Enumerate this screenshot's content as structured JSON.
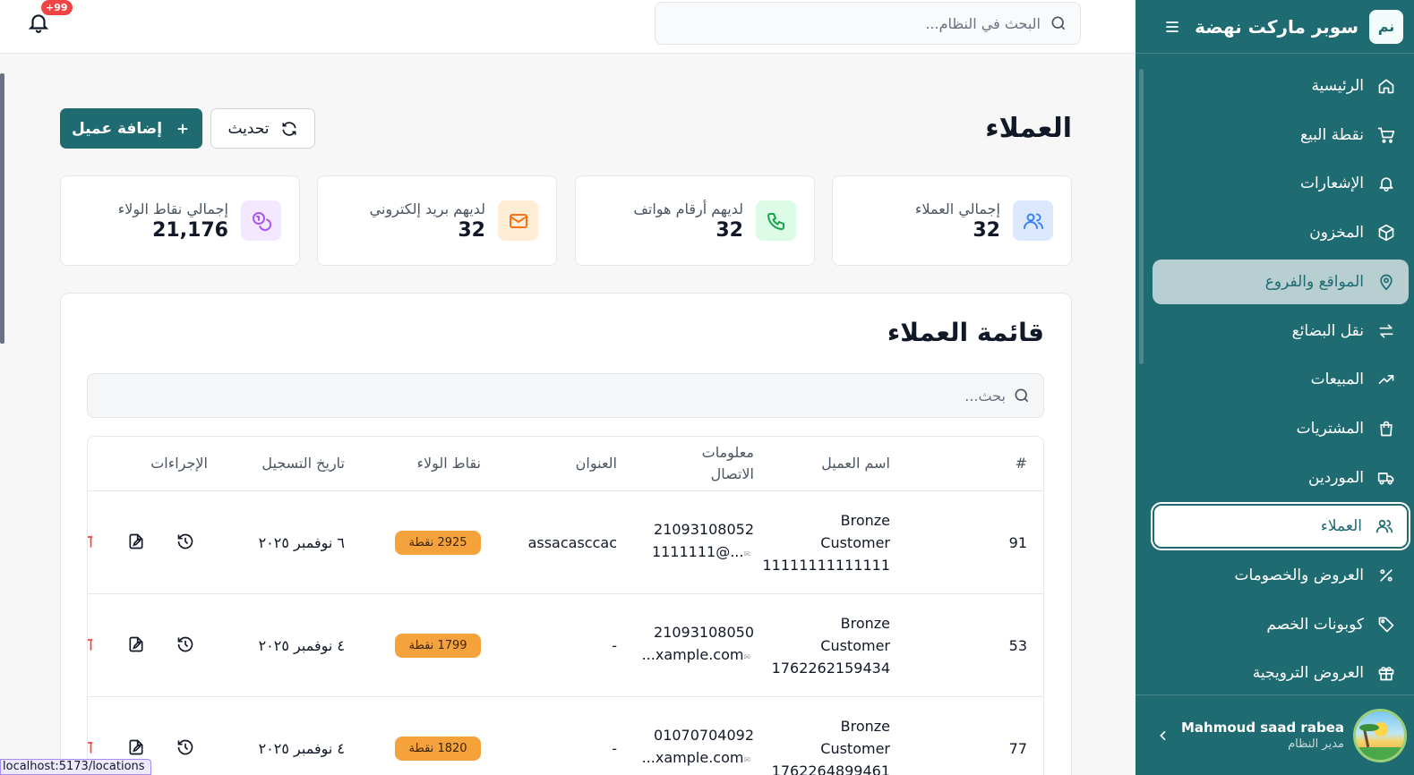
{
  "brand": {
    "logo": "نم",
    "name": "سوبر ماركت نهضة"
  },
  "sidebar": {
    "items": [
      {
        "label": "الرئيسية",
        "icon": "home-icon"
      },
      {
        "label": "نقطة البيع",
        "icon": "cart-icon"
      },
      {
        "label": "الإشعارات",
        "icon": "bell-icon"
      },
      {
        "label": "المخزون",
        "icon": "box-icon"
      },
      {
        "label": "المواقع والفروع",
        "icon": "map-pin-icon"
      },
      {
        "label": "نقل البضائع",
        "icon": "transfer-icon"
      },
      {
        "label": "المبيعات",
        "icon": "trending-up-icon"
      },
      {
        "label": "المشتريات",
        "icon": "shopping-bag-icon"
      },
      {
        "label": "الموردين",
        "icon": "truck-icon"
      },
      {
        "label": "العملاء",
        "icon": "users-icon"
      },
      {
        "label": "العروض والخصومات",
        "icon": "percent-icon"
      },
      {
        "label": "كوبونات الخصم",
        "icon": "tag-icon"
      },
      {
        "label": "العروض الترويجية",
        "icon": "gift-icon"
      }
    ],
    "hover_index": 4,
    "active_index": 9
  },
  "user": {
    "name": "Mahmoud saad rabea",
    "role": "مدير النظام"
  },
  "topbar": {
    "search_placeholder": "البحث في النظام...",
    "notifications_badge": "+99"
  },
  "page": {
    "title": "العملاء",
    "add_button": "إضافة عميل",
    "refresh_button": "تحديث"
  },
  "stats": [
    {
      "label": "إجمالي العملاء",
      "value": "32",
      "icon": "users-icon",
      "color": "#3b82f6"
    },
    {
      "label": "لديهم أرقام هواتف",
      "value": "32",
      "icon": "phone-icon",
      "color": "#16a34a"
    },
    {
      "label": "لديهم بريد إلكتروني",
      "value": "32",
      "icon": "mail-icon",
      "color": "#f97316"
    },
    {
      "label": "إجمالي نقاط الولاء",
      "value": "21,176",
      "icon": "coins-icon",
      "color": "#a855f7"
    }
  ],
  "list": {
    "title": "قائمة العملاء",
    "search_placeholder": "بحث...",
    "columns": [
      "#",
      "اسم العميل",
      "معلومات الاتصال",
      "العنوان",
      "نقاط الولاء",
      "تاريخ التسجيل",
      "الإجراءات"
    ],
    "rows": [
      {
        "id": "91",
        "name_lines": [
          "Bronze",
          "Customer",
          "11111111111111"
        ],
        "phone": "21093108052",
        "email": "1111111@...",
        "address": "assacasccac",
        "points": "2925 نقطة",
        "date": "٦ نوفمبر ٢٠٢٥"
      },
      {
        "id": "53",
        "name_lines": [
          "Bronze",
          "Customer",
          "1762262159434"
        ],
        "phone": "21093108050",
        "email": "...xample.com",
        "address": "-",
        "points": "1799 نقطة",
        "date": "٤ نوفمبر ٢٠٢٥"
      },
      {
        "id": "77",
        "name_lines": [
          "Bronze",
          "Customer",
          "1762264899461"
        ],
        "phone": "01070704092",
        "email": "...xample.com",
        "address": "-",
        "points": "1820 نقطة",
        "date": "٤ نوفمبر ٢٠٢٥"
      }
    ]
  },
  "statusbar": {
    "url": "localhost:5173/locations"
  }
}
